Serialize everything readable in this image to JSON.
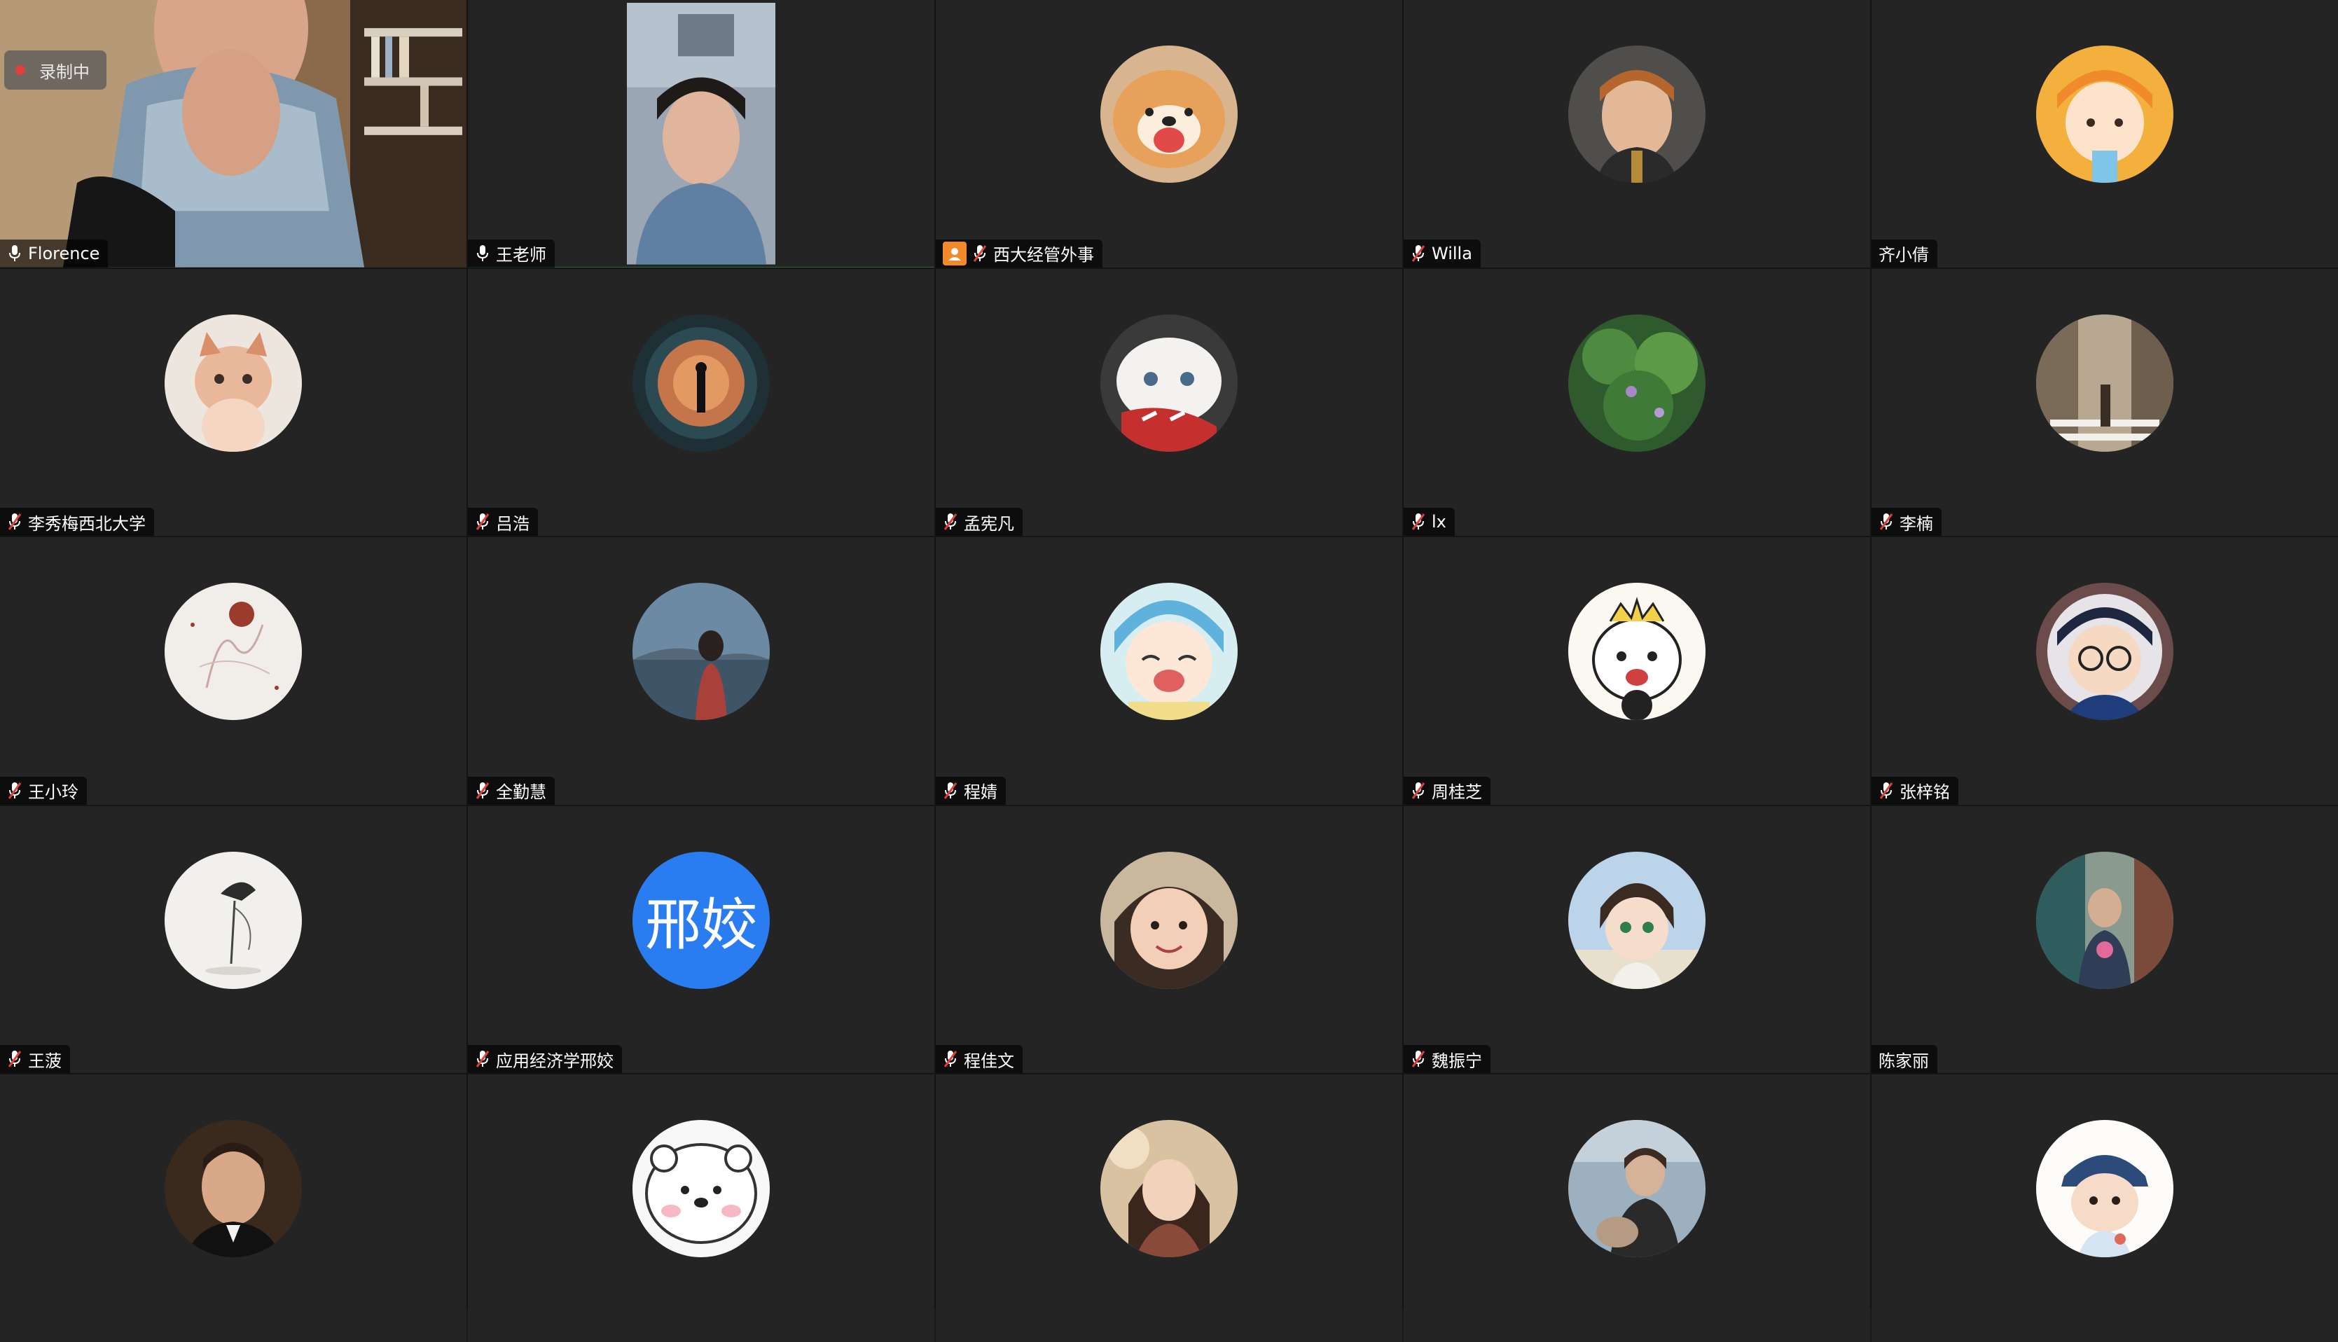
{
  "recording": {
    "label": "录制中",
    "dot_color": "#e0403a"
  },
  "accent": {
    "speaking_border": "#2fd05a",
    "host_badge": "#f2892a"
  },
  "participants": [
    {
      "name": "Florence",
      "mic": "on",
      "video": true
    },
    {
      "name": "王老师",
      "mic": "on",
      "video": true,
      "speaking": true
    },
    {
      "name": "西大经管外事",
      "mic": "muted",
      "host": true,
      "avatar": "shiba-dog-photo"
    },
    {
      "name": "Willa",
      "mic": "muted",
      "avatar": "boy-portrait-photo"
    },
    {
      "name": "齐小倩",
      "mic": "none",
      "avatar": "cartoon-girl-orange-hat"
    },
    {
      "name": "李秀梅西北大学",
      "mic": "muted",
      "avatar": "kitten-photo"
    },
    {
      "name": "吕浩",
      "mic": "muted",
      "avatar": "space-tunnel-figure"
    },
    {
      "name": "孟宪凡",
      "mic": "muted",
      "avatar": "white-cat-red-scarf"
    },
    {
      "name": "lx",
      "mic": "muted",
      "avatar": "green-plants"
    },
    {
      "name": "李楠",
      "mic": "muted",
      "avatar": "crosswalk-street"
    },
    {
      "name": "王小玲",
      "mic": "muted",
      "avatar": "sketch-drawing"
    },
    {
      "name": "全勤慧",
      "mic": "muted",
      "avatar": "lake-silhouette"
    },
    {
      "name": "程婧",
      "mic": "muted",
      "avatar": "anime-blue-hair-girl"
    },
    {
      "name": "周桂芝",
      "mic": "muted",
      "avatar": "cartoon-prince-camera"
    },
    {
      "name": "张梓铭",
      "mic": "muted",
      "avatar": "detective-conan"
    },
    {
      "name": "王菠",
      "mic": "muted",
      "avatar": "ink-heron"
    },
    {
      "name": "应用经济学邢姣",
      "mic": "muted",
      "avatar_initials": "邢姣",
      "avatar_color": "#2a7df0"
    },
    {
      "name": "程佳文",
      "mic": "muted",
      "avatar": "smiling-child-photo"
    },
    {
      "name": "魏振宁",
      "mic": "muted",
      "avatar": "cartoon-girl-sky"
    },
    {
      "name": "陈家丽",
      "mic": "none",
      "avatar": "person-flowers-street"
    },
    {
      "name": "",
      "mic": "muted",
      "avatar": "actor-portrait"
    },
    {
      "name": "",
      "mic": "muted",
      "avatar": "white-bear-cartoon"
    },
    {
      "name": "",
      "mic": "muted",
      "avatar": "woman-scarf-photo"
    },
    {
      "name": "",
      "mic": "muted",
      "avatar": "man-street-photo"
    },
    {
      "name": "",
      "mic": "muted",
      "avatar": "cartoon-boy-cap"
    }
  ]
}
